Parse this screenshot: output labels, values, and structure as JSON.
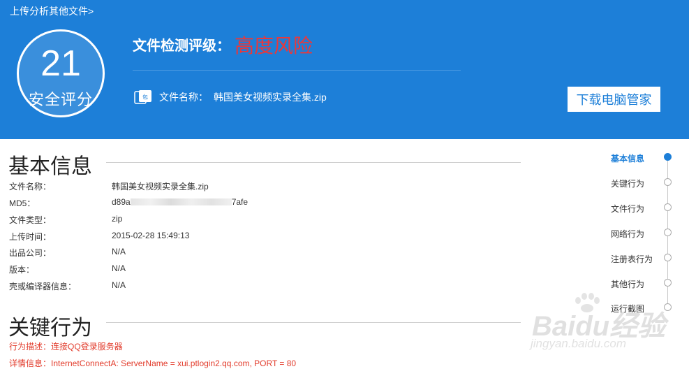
{
  "header": {
    "upload_link": "上传分析其他文件>",
    "score": "21",
    "score_label": "安全评分",
    "rating_label": "文件检测评级：",
    "rating_value": "高度风险",
    "file_label": "文件名称：",
    "file_name": "韩国美女视频实录全集.zip",
    "download_button": "下载电脑管家"
  },
  "basic_info": {
    "title": "基本信息",
    "rows": [
      {
        "key": "文件名称：",
        "value": "韩国美女视频实录全集.zip"
      },
      {
        "key": "MD5：",
        "value_prefix": "d89a",
        "value_suffix": "7afe"
      },
      {
        "key": "文件类型：",
        "value": "zip"
      },
      {
        "key": "上传时间：",
        "value": "2015-02-28 15:49:13"
      },
      {
        "key": "出品公司：",
        "value": "N/A"
      },
      {
        "key": "版本：",
        "value": "N/A"
      },
      {
        "key": "壳或编译器信息：",
        "value": "N/A"
      }
    ]
  },
  "key_behavior": {
    "title": "关键行为",
    "description": "行为描述：连接QQ登录服务器",
    "detail": "详情信息：InternetConnectA: ServerName = xui.ptlogin2.qq.com, PORT = 80"
  },
  "side_nav": {
    "items": [
      "基本信息",
      "关键行为",
      "文件行为",
      "网络行为",
      "注册表行为",
      "其他行为",
      "运行截图"
    ],
    "active_index": 0
  },
  "watermark": {
    "logo": "Baidu经验",
    "url": "jingyan.baidu.com"
  },
  "colors": {
    "banner": "#1d7fd8",
    "danger": "#e9383b",
    "detail_text": "#e23b2b"
  }
}
